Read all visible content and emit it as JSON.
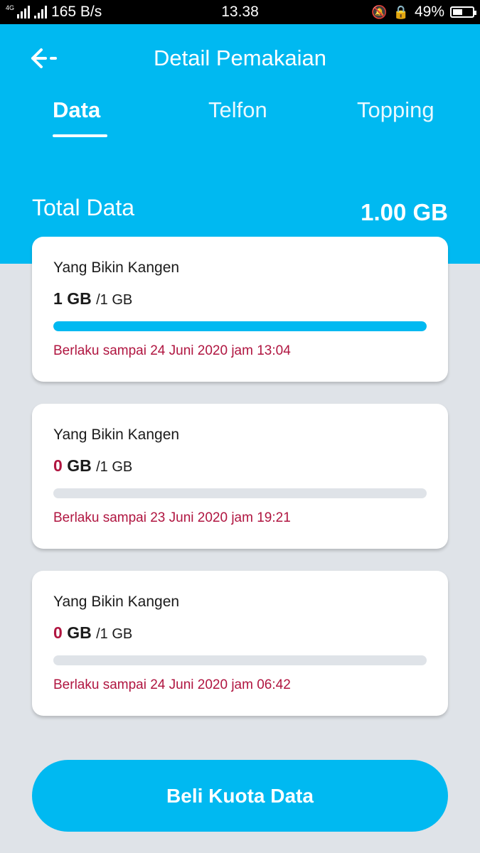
{
  "status_bar": {
    "network_type": "4G",
    "speed": "165 B/s",
    "time": "13.38",
    "battery": "49%",
    "battery_level": 0.49
  },
  "header": {
    "title": "Detail Pemakaian",
    "tabs": [
      {
        "label": "Data",
        "active": true
      },
      {
        "label": "Telfon",
        "active": false
      },
      {
        "label": "Topping",
        "active": false
      }
    ],
    "total_label": "Total Data",
    "total_value": "1.00 GB"
  },
  "cards": [
    {
      "name": "Yang Bikin Kangen",
      "used": "1",
      "unit": "GB",
      "quota": "/1 GB",
      "usage_fraction": 1.0,
      "expiry": "Berlaku sampai 24 Juni 2020 jam 13:04"
    },
    {
      "name": "Yang Bikin Kangen",
      "used": "0",
      "unit": "GB",
      "quota": "/1 GB",
      "usage_fraction": 0.0,
      "expiry": "Berlaku sampai 23 Juni 2020 jam 19:21"
    },
    {
      "name": "Yang Bikin Kangen",
      "used": "0",
      "unit": "GB",
      "quota": "/1 GB",
      "usage_fraction": 0.0,
      "expiry": "Berlaku sampai 24 Juni 2020 jam 06:42"
    }
  ],
  "buy_button_label": "Beli Kuota Data",
  "colors": {
    "brand": "#00b9f1",
    "accent_red": "#b01540",
    "background": "#dfe3e8"
  }
}
